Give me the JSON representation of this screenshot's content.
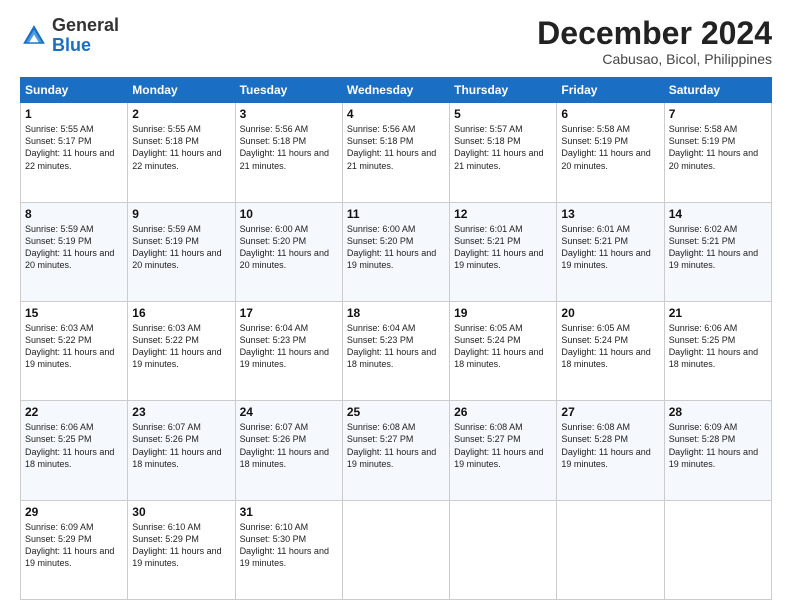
{
  "header": {
    "logo_line1": "General",
    "logo_line2": "Blue",
    "month": "December 2024",
    "location": "Cabusao, Bicol, Philippines"
  },
  "days_of_week": [
    "Sunday",
    "Monday",
    "Tuesday",
    "Wednesday",
    "Thursday",
    "Friday",
    "Saturday"
  ],
  "weeks": [
    [
      {
        "day": 1,
        "sunrise": "5:55 AM",
        "sunset": "5:17 PM",
        "daylight": "11 hours and 22 minutes."
      },
      {
        "day": 2,
        "sunrise": "5:55 AM",
        "sunset": "5:18 PM",
        "daylight": "11 hours and 22 minutes."
      },
      {
        "day": 3,
        "sunrise": "5:56 AM",
        "sunset": "5:18 PM",
        "daylight": "11 hours and 21 minutes."
      },
      {
        "day": 4,
        "sunrise": "5:56 AM",
        "sunset": "5:18 PM",
        "daylight": "11 hours and 21 minutes."
      },
      {
        "day": 5,
        "sunrise": "5:57 AM",
        "sunset": "5:18 PM",
        "daylight": "11 hours and 21 minutes."
      },
      {
        "day": 6,
        "sunrise": "5:58 AM",
        "sunset": "5:19 PM",
        "daylight": "11 hours and 20 minutes."
      },
      {
        "day": 7,
        "sunrise": "5:58 AM",
        "sunset": "5:19 PM",
        "daylight": "11 hours and 20 minutes."
      }
    ],
    [
      {
        "day": 8,
        "sunrise": "5:59 AM",
        "sunset": "5:19 PM",
        "daylight": "11 hours and 20 minutes."
      },
      {
        "day": 9,
        "sunrise": "5:59 AM",
        "sunset": "5:19 PM",
        "daylight": "11 hours and 20 minutes."
      },
      {
        "day": 10,
        "sunrise": "6:00 AM",
        "sunset": "5:20 PM",
        "daylight": "11 hours and 20 minutes."
      },
      {
        "day": 11,
        "sunrise": "6:00 AM",
        "sunset": "5:20 PM",
        "daylight": "11 hours and 19 minutes."
      },
      {
        "day": 12,
        "sunrise": "6:01 AM",
        "sunset": "5:21 PM",
        "daylight": "11 hours and 19 minutes."
      },
      {
        "day": 13,
        "sunrise": "6:01 AM",
        "sunset": "5:21 PM",
        "daylight": "11 hours and 19 minutes."
      },
      {
        "day": 14,
        "sunrise": "6:02 AM",
        "sunset": "5:21 PM",
        "daylight": "11 hours and 19 minutes."
      }
    ],
    [
      {
        "day": 15,
        "sunrise": "6:03 AM",
        "sunset": "5:22 PM",
        "daylight": "11 hours and 19 minutes."
      },
      {
        "day": 16,
        "sunrise": "6:03 AM",
        "sunset": "5:22 PM",
        "daylight": "11 hours and 19 minutes."
      },
      {
        "day": 17,
        "sunrise": "6:04 AM",
        "sunset": "5:23 PM",
        "daylight": "11 hours and 19 minutes."
      },
      {
        "day": 18,
        "sunrise": "6:04 AM",
        "sunset": "5:23 PM",
        "daylight": "11 hours and 18 minutes."
      },
      {
        "day": 19,
        "sunrise": "6:05 AM",
        "sunset": "5:24 PM",
        "daylight": "11 hours and 18 minutes."
      },
      {
        "day": 20,
        "sunrise": "6:05 AM",
        "sunset": "5:24 PM",
        "daylight": "11 hours and 18 minutes."
      },
      {
        "day": 21,
        "sunrise": "6:06 AM",
        "sunset": "5:25 PM",
        "daylight": "11 hours and 18 minutes."
      }
    ],
    [
      {
        "day": 22,
        "sunrise": "6:06 AM",
        "sunset": "5:25 PM",
        "daylight": "11 hours and 18 minutes."
      },
      {
        "day": 23,
        "sunrise": "6:07 AM",
        "sunset": "5:26 PM",
        "daylight": "11 hours and 18 minutes."
      },
      {
        "day": 24,
        "sunrise": "6:07 AM",
        "sunset": "5:26 PM",
        "daylight": "11 hours and 18 minutes."
      },
      {
        "day": 25,
        "sunrise": "6:08 AM",
        "sunset": "5:27 PM",
        "daylight": "11 hours and 19 minutes."
      },
      {
        "day": 26,
        "sunrise": "6:08 AM",
        "sunset": "5:27 PM",
        "daylight": "11 hours and 19 minutes."
      },
      {
        "day": 27,
        "sunrise": "6:08 AM",
        "sunset": "5:28 PM",
        "daylight": "11 hours and 19 minutes."
      },
      {
        "day": 28,
        "sunrise": "6:09 AM",
        "sunset": "5:28 PM",
        "daylight": "11 hours and 19 minutes."
      }
    ],
    [
      {
        "day": 29,
        "sunrise": "6:09 AM",
        "sunset": "5:29 PM",
        "daylight": "11 hours and 19 minutes."
      },
      {
        "day": 30,
        "sunrise": "6:10 AM",
        "sunset": "5:29 PM",
        "daylight": "11 hours and 19 minutes."
      },
      {
        "day": 31,
        "sunrise": "6:10 AM",
        "sunset": "5:30 PM",
        "daylight": "11 hours and 19 minutes."
      },
      null,
      null,
      null,
      null
    ]
  ]
}
